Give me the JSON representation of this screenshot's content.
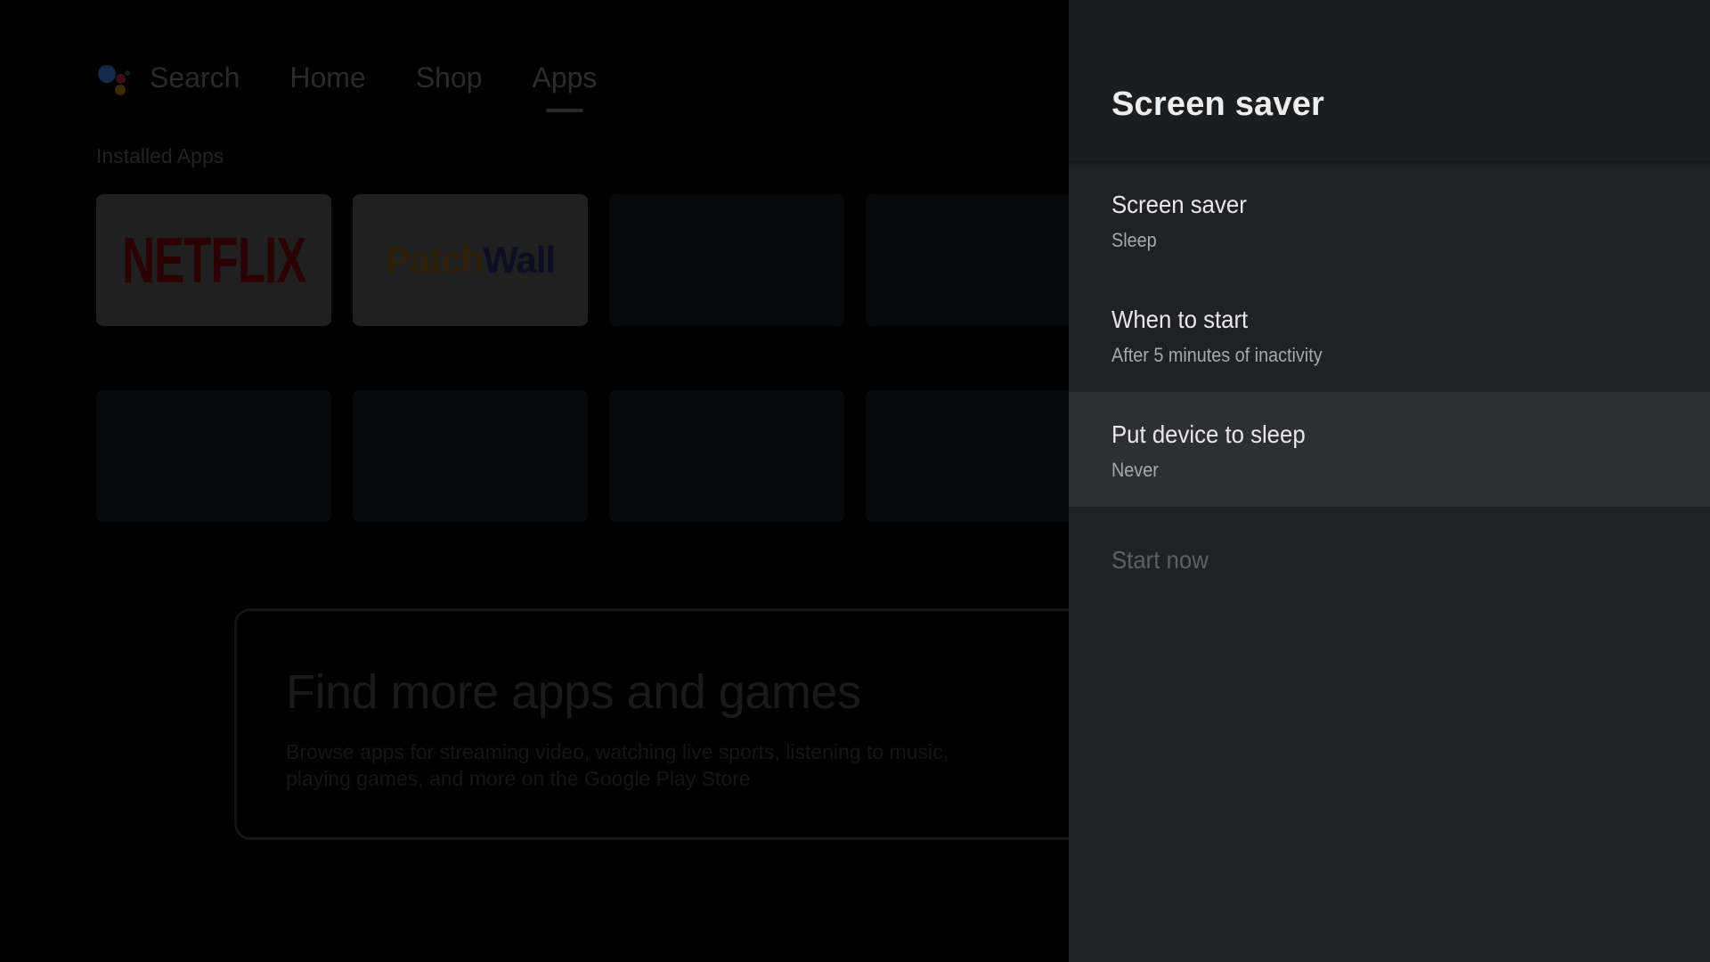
{
  "launcher": {
    "nav": [
      {
        "label": "Search",
        "active": false
      },
      {
        "label": "Home",
        "active": false
      },
      {
        "label": "Shop",
        "active": false
      },
      {
        "label": "Apps",
        "active": true
      }
    ],
    "assistant_icon": "google-assistant-icon",
    "section_title": "Installed Apps",
    "apps": [
      {
        "name": "Netflix",
        "logo_text": "NETFLIX",
        "logo_color": "#e50914"
      },
      {
        "name": "PatchWall",
        "logo_text_1": "Patch",
        "logo_text_2": "Wall"
      }
    ],
    "promo": {
      "title": "Find more apps and games",
      "description": "Browse apps for streaming video, watching live sports, listening to music, playing games, and more on the Google Play Store"
    }
  },
  "panel": {
    "title": "Screen saver",
    "items": [
      {
        "title": "Screen saver",
        "summary": "Sleep",
        "focused": false,
        "enabled": true
      },
      {
        "title": "When to start",
        "summary": "After 5 minutes of inactivity",
        "focused": false,
        "enabled": true
      },
      {
        "title": "Put device to sleep",
        "summary": "Never",
        "focused": true,
        "enabled": true
      },
      {
        "title": "Start now",
        "summary": "",
        "focused": false,
        "enabled": false
      }
    ]
  },
  "colors": {
    "panel_bg": "#202124",
    "panel_header_bg": "#1c1d1f",
    "focused_row_bg": "#2e2f33",
    "primary_text": "#e8e8e8",
    "secondary_text": "#a8a8a8",
    "disabled_text": "#5e5f62"
  }
}
